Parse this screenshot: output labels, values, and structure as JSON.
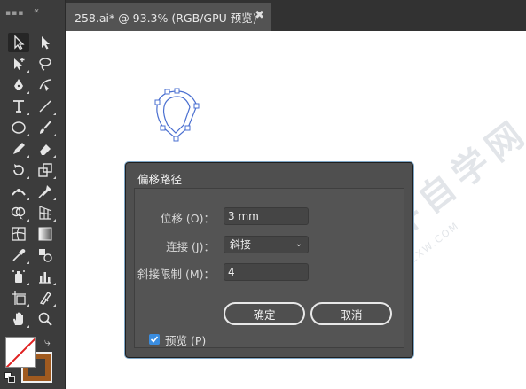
{
  "document_tab": {
    "title": "258.ai* @ 93.3% (RGB/GPU 预览)",
    "close_glyph": "✖"
  },
  "toolbar": {
    "collapse_glyph": "«",
    "tools": [
      "selection-tool-icon",
      "direct-selection-tool-icon",
      "group-selection-tool-icon",
      "lasso-tool-icon",
      "pen-tool-icon",
      "curvature-tool-icon",
      "type-tool-icon",
      "line-segment-tool-icon",
      "ellipse-tool-icon",
      "paintbrush-tool-icon",
      "pencil-tool-icon",
      "eraser-tool-icon",
      "rotate-tool-icon",
      "scale-tool-icon",
      "width-tool-icon",
      "puppet-warp-tool-icon",
      "shape-builder-tool-icon",
      "perspective-grid-tool-icon",
      "mesh-tool-icon",
      "gradient-tool-icon",
      "eyedropper-tool-icon",
      "blend-tool-icon",
      "symbol-sprayer-tool-icon",
      "column-graph-tool-icon",
      "artboard-tool-icon",
      "slice-tool-icon",
      "hand-tool-icon",
      "zoom-tool-icon"
    ],
    "colors": {
      "fill": "#a05a1f",
      "stroke": "none"
    }
  },
  "watermark": {
    "text": "软件自学网",
    "url": "WWW.RJZXW.COM"
  },
  "dialog": {
    "title": "偏移路径",
    "offset_label": "位移 (O)：",
    "offset_value": "3 mm",
    "joins_label": "连接 (J)：",
    "joins_value": "斜接",
    "miter_label": "斜接限制 (M)：",
    "miter_value": "4",
    "preview_label": "预览 (P)",
    "preview_checked": true,
    "ok_label": "确定",
    "cancel_label": "取消"
  }
}
